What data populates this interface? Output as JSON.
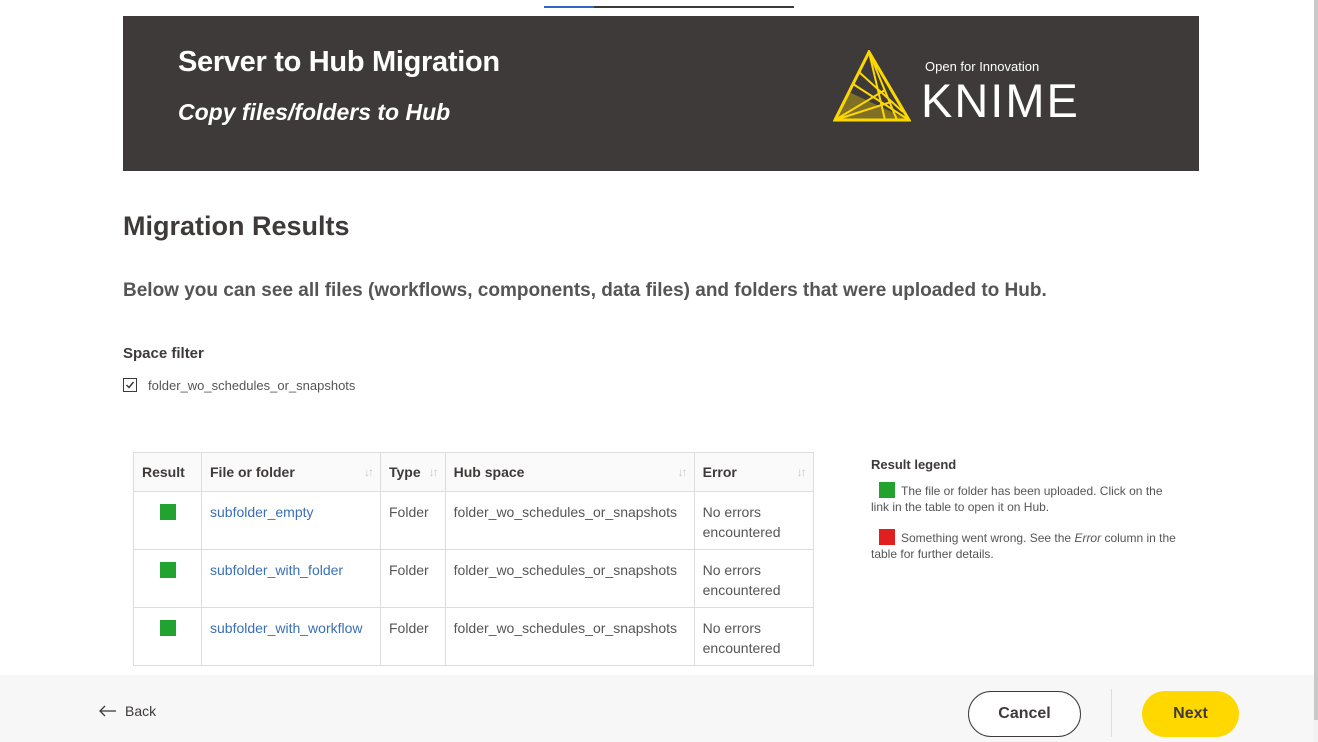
{
  "progress": {
    "completed_fraction": 0.2
  },
  "banner": {
    "title": "Server to Hub Migration",
    "subtitle": "Copy files/folders to Hub",
    "logo_tagline": "Open for Innovation",
    "logo_word": "KNIME"
  },
  "main": {
    "title": "Migration Results",
    "description": "Below you can see all files (workflows, components, data files) and folders that were uploaded to Hub."
  },
  "space_filter": {
    "label": "Space filter",
    "options": [
      {
        "label": "folder_wo_schedules_or_snapshots",
        "checked": true
      }
    ]
  },
  "table": {
    "columns": [
      "Result",
      "File or folder",
      "Type",
      "Hub space",
      "Error"
    ],
    "rows": [
      {
        "result": "success",
        "name": "subfolder_empty",
        "type": "Folder",
        "hub_space": "folder_wo_schedules_or_snapshots",
        "error": "No errors encountered"
      },
      {
        "result": "success",
        "name": "subfolder_with_folder",
        "type": "Folder",
        "hub_space": "folder_wo_schedules_or_snapshots",
        "error": "No errors encountered"
      },
      {
        "result": "success",
        "name": "subfolder_with_workflow",
        "type": "Folder",
        "hub_space": "folder_wo_schedules_or_snapshots",
        "error": "No errors encountered"
      }
    ]
  },
  "legend": {
    "title": "Result legend",
    "success_text": "The file or folder has been uploaded. Click on the link in the table to open it on Hub.",
    "error_text_before": "Something went wrong. See the ",
    "error_text_em": "Error",
    "error_text_after": " column in the table for further details."
  },
  "footer": {
    "back_label": "Back",
    "cancel_label": "Cancel",
    "next_label": "Next"
  },
  "colors": {
    "banner_bg": "#3e3a39",
    "success": "#22a32f",
    "error": "#e01f1f",
    "accent_yellow": "#ffd800",
    "logo_yellow": "#fdd800",
    "link": "#3a6fb5"
  },
  "icons": {
    "sort": "sort-arrows-icon",
    "back": "arrow-left-icon",
    "checkbox": "checkmark-icon",
    "logo": "knime-triangle-logo-icon"
  }
}
